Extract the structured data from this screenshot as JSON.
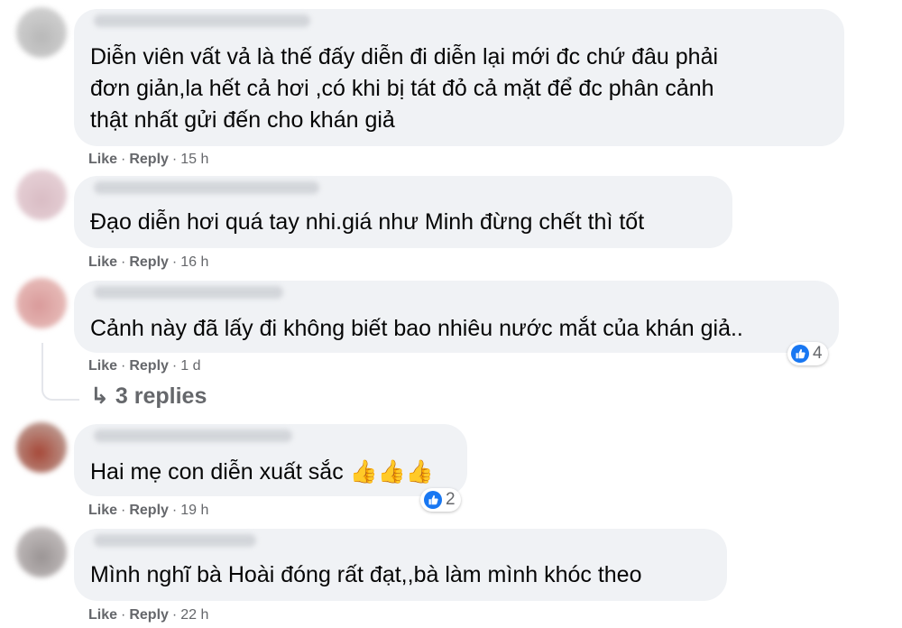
{
  "comments": [
    {
      "text": "Diễn viên vất vả là thế đấy diễn đi diễn lại mới đc chứ đâu phải\nđơn giản,la hết cả hơi ,có khi bị tát đỏ cả mặt để đc phân cảnh\nthật nhất gửi đến cho khán giả",
      "like": "Like",
      "reply": "Reply",
      "time": "15 h"
    },
    {
      "text": "Đạo diễn hơi quá tay nhi.giá như Minh đừng chết thì tốt",
      "like": "Like",
      "reply": "Reply",
      "time": "16 h"
    },
    {
      "text": "Cảnh này đã lấy đi không biết bao nhiêu nước mắt của khán giả..",
      "like": "Like",
      "reply": "Reply",
      "time": "1 d",
      "reactions": "4",
      "replies_label": "3 replies"
    },
    {
      "text": "Hai mẹ con diễn xuất sắc 👍👍👍",
      "like": "Like",
      "reply": "Reply",
      "time": "19 h",
      "reactions": "2"
    },
    {
      "text": "Mình nghĩ bà Hoài đóng rất đạt,,bà làm mình khóc theo",
      "like": "Like",
      "reply": "Reply",
      "time": "22 h"
    }
  ],
  "colors": {
    "bubble": "#f0f2f5",
    "meta": "#65676b",
    "like_badge": "#1877f2"
  }
}
